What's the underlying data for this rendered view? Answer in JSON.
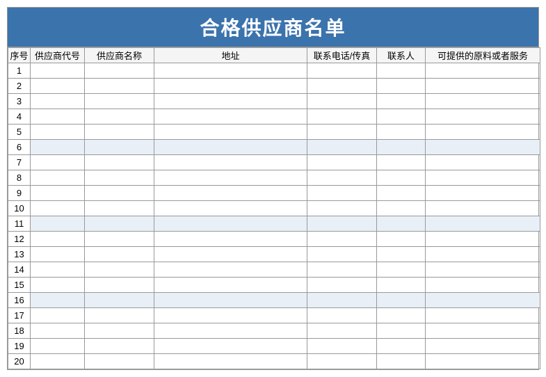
{
  "title": "合格供应商名单",
  "headers": {
    "seq": "序号",
    "code": "供应商代号",
    "name": "供应商名称",
    "addr": "地址",
    "phone": "联系电话/传真",
    "contact": "联系人",
    "service": "可提供的原料或者服务"
  },
  "rows": [
    {
      "seq": "1",
      "code": "",
      "name": "",
      "addr": "",
      "phone": "",
      "contact": "",
      "service": "",
      "highlight": false
    },
    {
      "seq": "2",
      "code": "",
      "name": "",
      "addr": "",
      "phone": "",
      "contact": "",
      "service": "",
      "highlight": false
    },
    {
      "seq": "3",
      "code": "",
      "name": "",
      "addr": "",
      "phone": "",
      "contact": "",
      "service": "",
      "highlight": false
    },
    {
      "seq": "4",
      "code": "",
      "name": "",
      "addr": "",
      "phone": "",
      "contact": "",
      "service": "",
      "highlight": false
    },
    {
      "seq": "5",
      "code": "",
      "name": "",
      "addr": "",
      "phone": "",
      "contact": "",
      "service": "",
      "highlight": false
    },
    {
      "seq": "6",
      "code": "",
      "name": "",
      "addr": "",
      "phone": "",
      "contact": "",
      "service": "",
      "highlight": true
    },
    {
      "seq": "7",
      "code": "",
      "name": "",
      "addr": "",
      "phone": "",
      "contact": "",
      "service": "",
      "highlight": false
    },
    {
      "seq": "8",
      "code": "",
      "name": "",
      "addr": "",
      "phone": "",
      "contact": "",
      "service": "",
      "highlight": false
    },
    {
      "seq": "9",
      "code": "",
      "name": "",
      "addr": "",
      "phone": "",
      "contact": "",
      "service": "",
      "highlight": false
    },
    {
      "seq": "10",
      "code": "",
      "name": "",
      "addr": "",
      "phone": "",
      "contact": "",
      "service": "",
      "highlight": false
    },
    {
      "seq": "11",
      "code": "",
      "name": "",
      "addr": "",
      "phone": "",
      "contact": "",
      "service": "",
      "highlight": true
    },
    {
      "seq": "12",
      "code": "",
      "name": "",
      "addr": "",
      "phone": "",
      "contact": "",
      "service": "",
      "highlight": false
    },
    {
      "seq": "13",
      "code": "",
      "name": "",
      "addr": "",
      "phone": "",
      "contact": "",
      "service": "",
      "highlight": false
    },
    {
      "seq": "14",
      "code": "",
      "name": "",
      "addr": "",
      "phone": "",
      "contact": "",
      "service": "",
      "highlight": false
    },
    {
      "seq": "15",
      "code": "",
      "name": "",
      "addr": "",
      "phone": "",
      "contact": "",
      "service": "",
      "highlight": false
    },
    {
      "seq": "16",
      "code": "",
      "name": "",
      "addr": "",
      "phone": "",
      "contact": "",
      "service": "",
      "highlight": true
    },
    {
      "seq": "17",
      "code": "",
      "name": "",
      "addr": "",
      "phone": "",
      "contact": "",
      "service": "",
      "highlight": false
    },
    {
      "seq": "18",
      "code": "",
      "name": "",
      "addr": "",
      "phone": "",
      "contact": "",
      "service": "",
      "highlight": false
    },
    {
      "seq": "19",
      "code": "",
      "name": "",
      "addr": "",
      "phone": "",
      "contact": "",
      "service": "",
      "highlight": false
    },
    {
      "seq": "20",
      "code": "",
      "name": "",
      "addr": "",
      "phone": "",
      "contact": "",
      "service": "",
      "highlight": false
    }
  ]
}
